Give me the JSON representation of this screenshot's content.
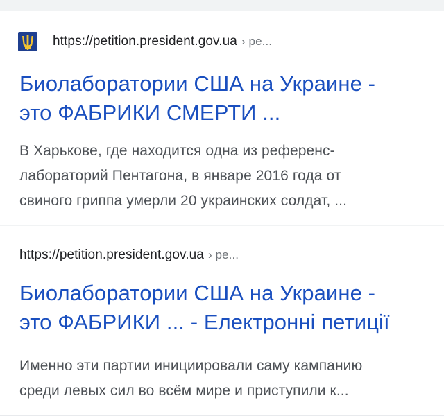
{
  "results": [
    {
      "url": "https://petition.president.gov.ua",
      "url_path": "› pe...",
      "has_favicon": true,
      "favicon_icon": "ukraine-trident-icon",
      "title_line1": "Биолаборатории США на Украине -",
      "title_line2": "это ФАБРИКИ СМЕРТИ ...",
      "snippet_line1": "В Харькове, где находится одна из референс-",
      "snippet_line2": "лабораторий Пентагона, в январе 2016 года от",
      "snippet_line3": "свиного гриппа умерли 20 украинских солдат, ..."
    },
    {
      "url": "https://petition.president.gov.ua",
      "url_path": "› pe...",
      "has_favicon": false,
      "title_line1": "Биолаборатории США на Украине -",
      "title_line2": "это ФАБРИКИ ... - Електронні петиції",
      "snippet_line1": "Именно эти партии инициировали саму кампанию",
      "snippet_line2": "среди левых сил во всём мире и приступили к..."
    }
  ],
  "colors": {
    "title_link": "#1a4fbf",
    "snippet_text": "#4d5156",
    "url_text": "#202124",
    "url_path": "#70757a",
    "page_background": "#f1f3f4",
    "card_background": "#ffffff",
    "favicon_background": "#1f3f8f",
    "favicon_trident": "#f2c230"
  }
}
